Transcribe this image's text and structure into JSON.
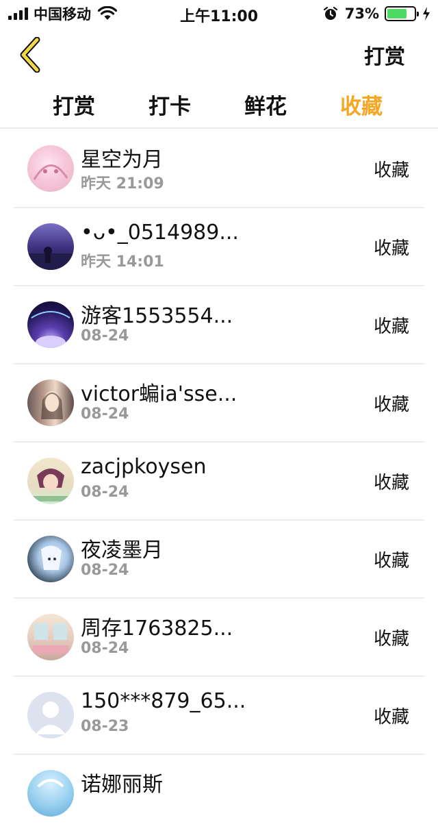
{
  "status_bar": {
    "carrier": "中国移动",
    "time": "上午11:00",
    "battery_percent_text": "73%",
    "battery_level": 0.73,
    "battery_color": "#4cd964"
  },
  "nav": {
    "back_icon": "chevron-left-icon",
    "back_color": "#f5d84a",
    "action_label": "打赏"
  },
  "tabs": [
    {
      "label": "打赏",
      "active": false
    },
    {
      "label": "打卡",
      "active": false
    },
    {
      "label": "鲜花",
      "active": false
    },
    {
      "label": "收藏",
      "active": true
    }
  ],
  "accent_color": "#f5a623",
  "list": [
    {
      "name": "星空为月",
      "time": "昨天 21:09",
      "action": "收藏"
    },
    {
      "name": "•ᴗ•_0514989...",
      "time": "昨天 14:01",
      "action": "收藏"
    },
    {
      "name": "游客1553554...",
      "time": "08-24",
      "action": "收藏"
    },
    {
      "name": "victor蝙ia'sse...",
      "time": "08-24",
      "action": "收藏"
    },
    {
      "name": "zacjpkoysen",
      "time": "08-24",
      "action": "收藏"
    },
    {
      "name": "夜凌墨月",
      "time": "08-24",
      "action": "收藏"
    },
    {
      "name": "周存1763825...",
      "time": "08-24",
      "action": "收藏"
    },
    {
      "name": "150***879_65...",
      "time": "08-23",
      "action": "收藏"
    },
    {
      "name": "诺娜丽斯",
      "time": "",
      "action": ""
    }
  ]
}
